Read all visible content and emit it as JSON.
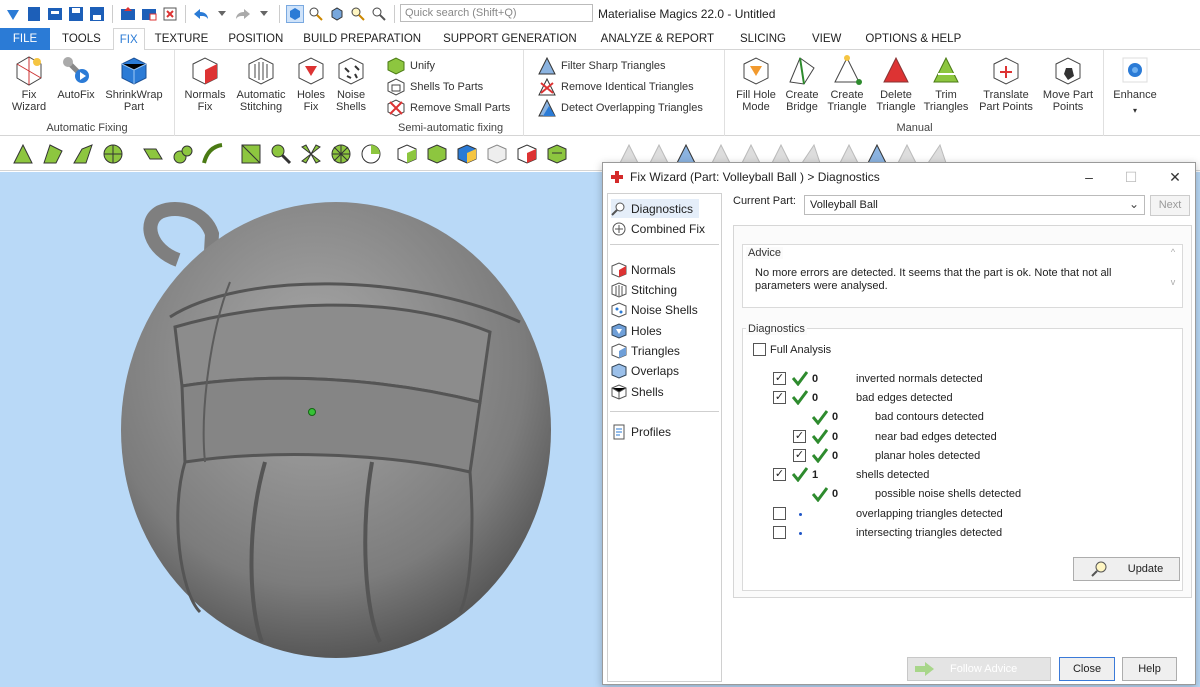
{
  "app": {
    "title": "Materialise Magics 22.0 - Untitled"
  },
  "search": {
    "placeholder": "Quick search (Shift+Q)"
  },
  "tabs": [
    "FILE",
    "TOOLS",
    "FIX",
    "TEXTURE",
    "POSITION",
    "BUILD PREPARATION",
    "SUPPORT GENERATION",
    "ANALYZE & REPORT",
    "SLICING",
    "VIEW",
    "OPTIONS & HELP"
  ],
  "ribbon": {
    "groups": {
      "automatic": "Automatic Fixing",
      "semi": "Semi-automatic fixing",
      "manual": "Manual"
    },
    "buttons": {
      "fix_wizard": "Fix\nWizard",
      "autofix": "AutoFix",
      "shrinkwrap": "ShrinkWrap\nPart",
      "normals_fix": "Normals\nFix",
      "auto_stitching": "Automatic\nStitching",
      "holes_fix": "Holes\nFix",
      "noise_shells": "Noise\nShells",
      "unify": "Unify",
      "shells_to_parts": "Shells To Parts",
      "remove_small_parts": "Remove Small Parts",
      "filter_sharp": "Filter Sharp Triangles",
      "remove_identical": "Remove Identical Triangles",
      "detect_overlapping": "Detect Overlapping Triangles",
      "fill_hole": "Fill Hole\nMode",
      "create_bridge": "Create\nBridge",
      "create_triangle": "Create\nTriangle",
      "delete_triangle": "Delete\nTriangle",
      "trim_triangles": "Trim\nTriangles",
      "translate_points": "Translate\nPart Points",
      "move_points": "Move Part\nPoints",
      "enhance": "Enhance"
    }
  },
  "dialog": {
    "title": "Fix Wizard (Part: Volleyball Ball ) > Diagnostics",
    "nav": {
      "diagnostics": "Diagnostics",
      "combined_fix": "Combined Fix",
      "normals": "Normals",
      "stitching": "Stitching",
      "noise_shells": "Noise Shells",
      "holes": "Holes",
      "triangles": "Triangles",
      "overlaps": "Overlaps",
      "shells": "Shells",
      "profiles": "Profiles"
    },
    "current_part_label": "Current Part:",
    "current_part_value": "Volleyball Ball",
    "next_label": "Next",
    "advice_label": "Advice",
    "advice_text": "No more errors are detected. It seems that the part is ok. Note that not all parameters were analysed.",
    "diagnostics_label": "Diagnostics",
    "full_analysis_label": "Full Analysis",
    "rows": [
      {
        "count": "0",
        "label": "inverted normals detected"
      },
      {
        "count": "0",
        "label": "bad edges detected"
      },
      {
        "count": "0",
        "label": "bad contours detected"
      },
      {
        "count": "0",
        "label": "near bad edges detected"
      },
      {
        "count": "0",
        "label": "planar holes detected"
      },
      {
        "count": "1",
        "label": "shells detected"
      },
      {
        "count": "0",
        "label": "possible noise shells detected"
      },
      {
        "count": "",
        "label": "overlapping triangles detected"
      },
      {
        "count": "",
        "label": "intersecting triangles detected"
      }
    ],
    "update_label": "Update",
    "follow_advice_label": "Follow Advice",
    "close_label": "Close",
    "help_label": "Help"
  },
  "colors": {
    "accent": "#2b7bd6",
    "viewport_bg": "#b9d9f7",
    "check_green": "#2e8b2e",
    "model_gray": "#8e8e8e"
  }
}
